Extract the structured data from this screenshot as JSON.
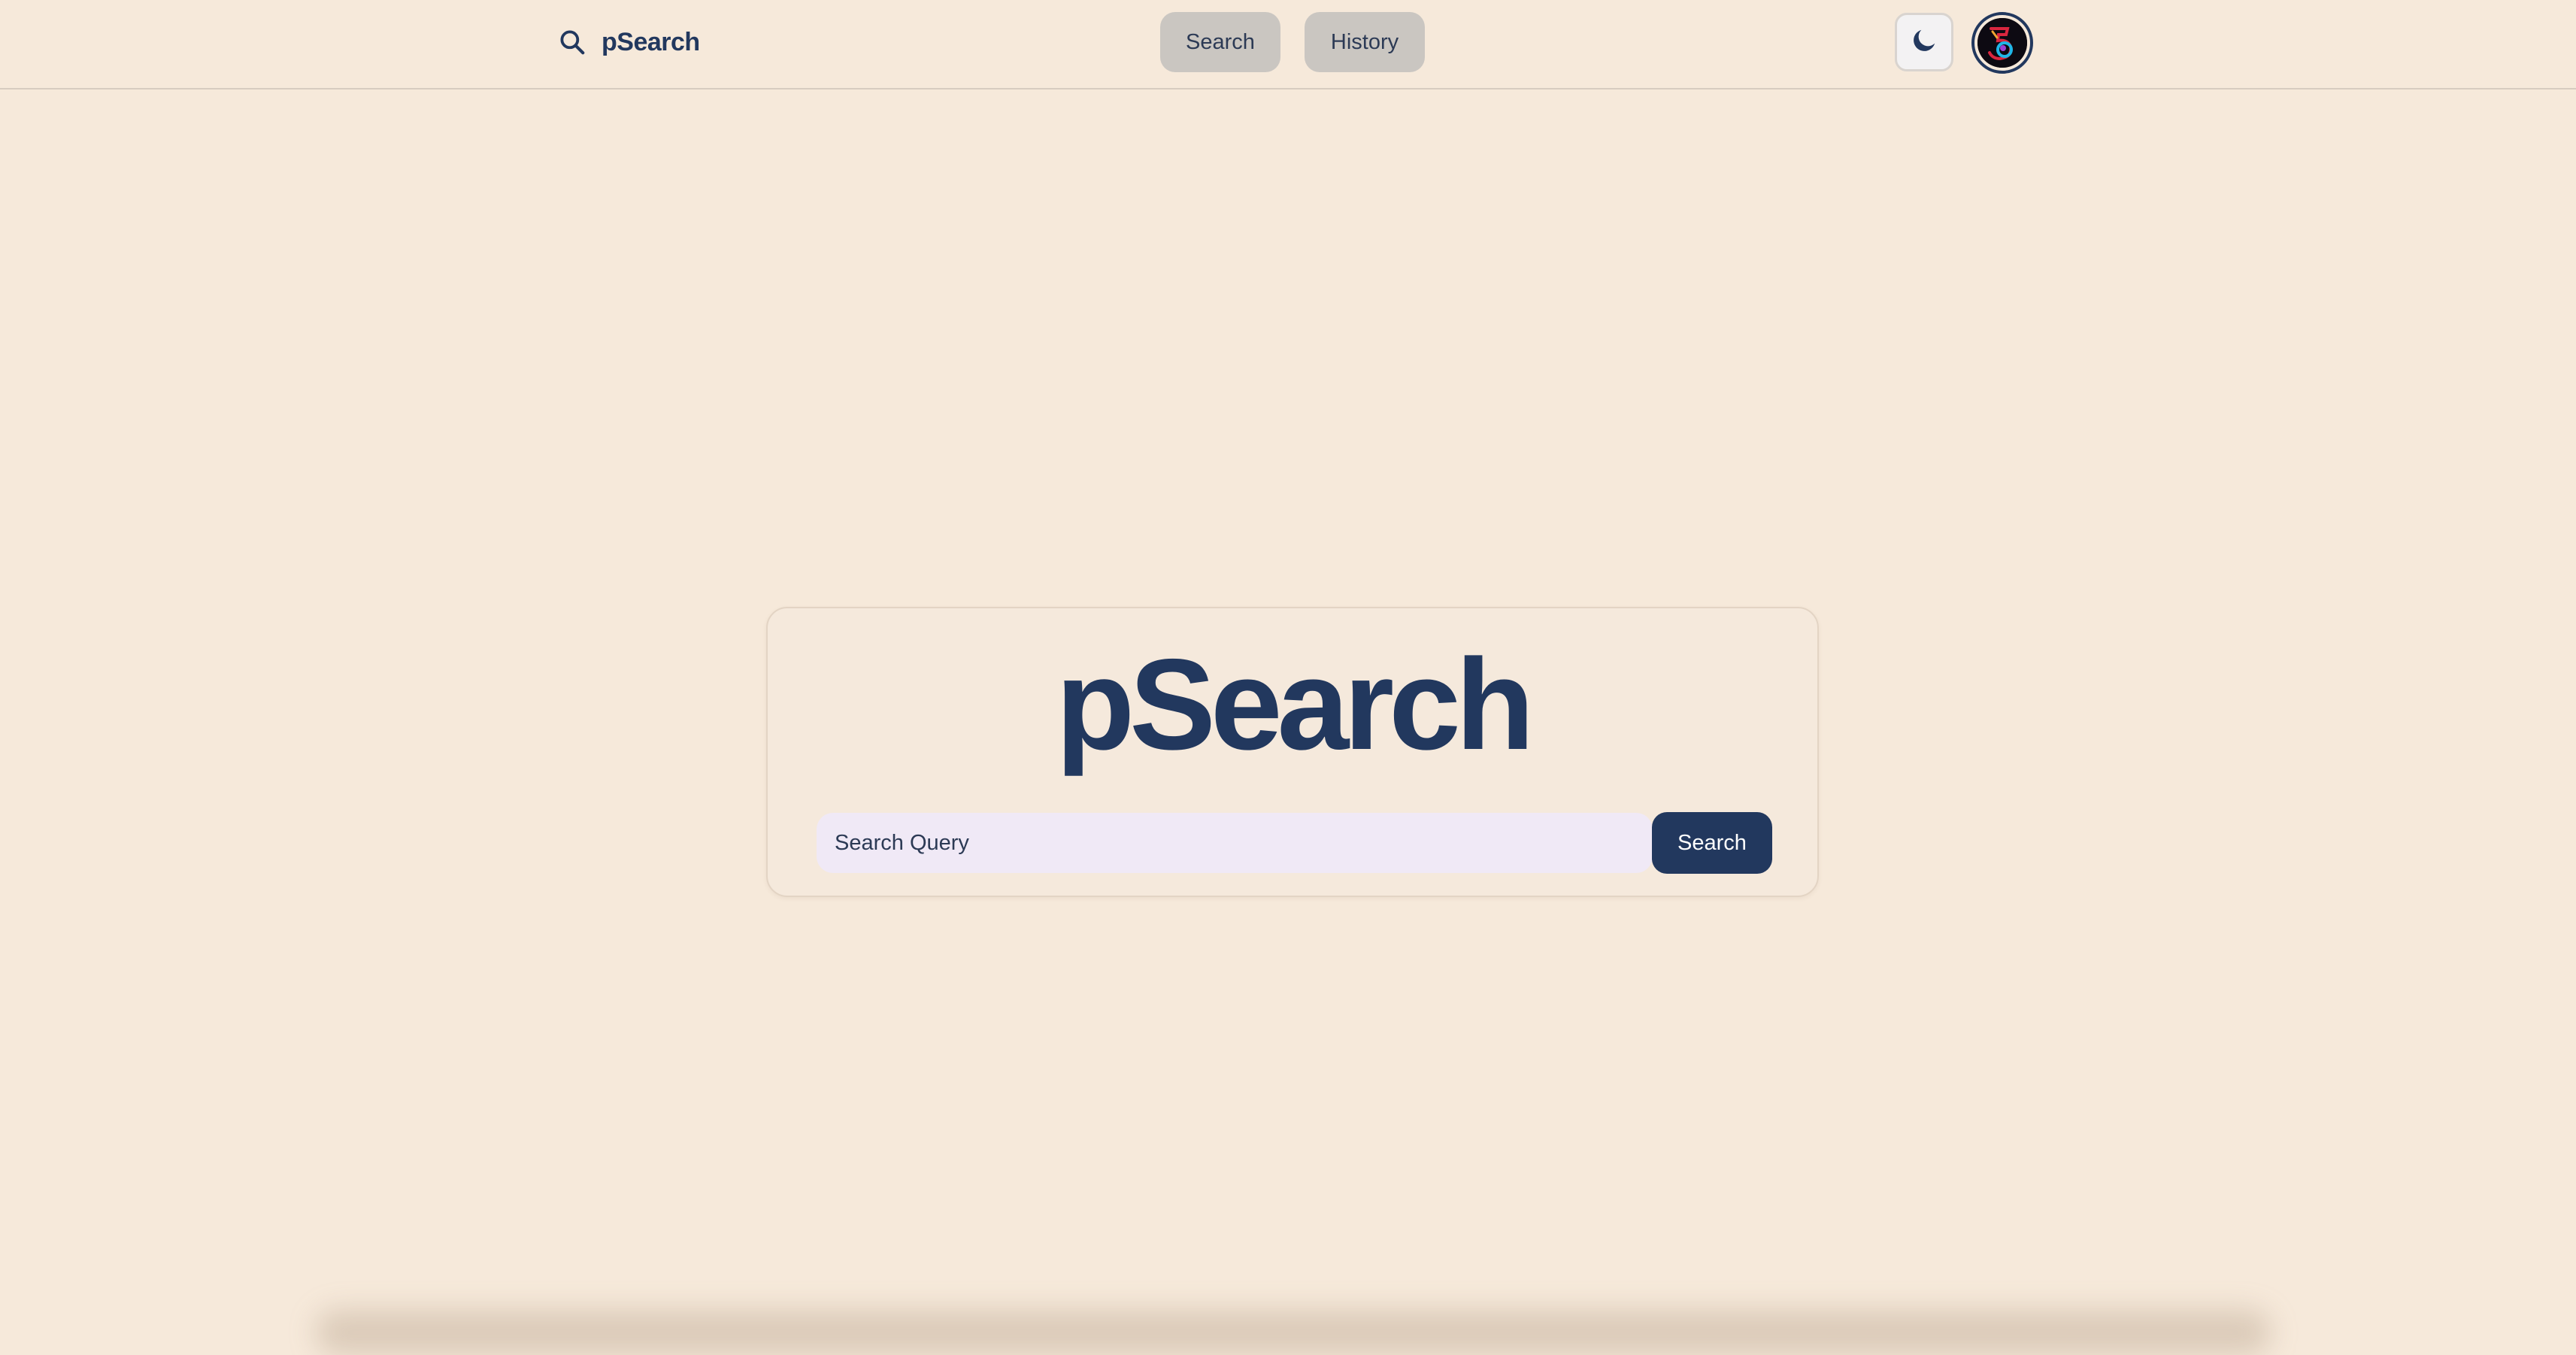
{
  "app": {
    "name": "pSearch",
    "icon": "search-icon"
  },
  "nav": {
    "tabs": [
      {
        "label": "Search"
      },
      {
        "label": "History"
      }
    ],
    "theme_toggle_icon": "moon-icon",
    "avatar_icon": "user-avatar"
  },
  "main": {
    "title": "pSearch",
    "search": {
      "placeholder": "Search Query",
      "value": "",
      "button_label": "Search"
    }
  },
  "colors": {
    "background": "#f6e9da",
    "primary": "#22385e",
    "tab_background": "#cac6c1",
    "input_background": "#f0e9f6"
  }
}
